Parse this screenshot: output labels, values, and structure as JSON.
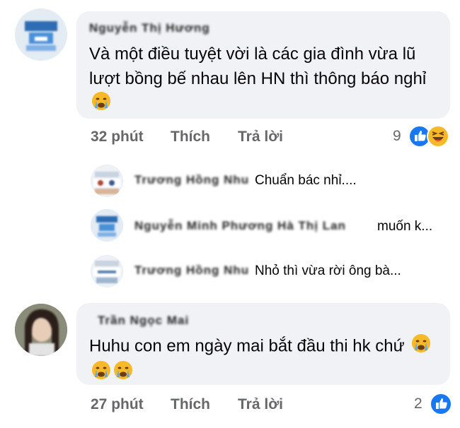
{
  "comments": [
    {
      "author": "Nguyễn Thị Hương",
      "text": "Và một điều tuyệt vời là các gia đình vừa lũ lượt bồng bế nhau lên HN thì thông báo nghỉ",
      "emoji": "crying-face",
      "time": "32 phút",
      "like_label": "Thích",
      "reply_label": "Trả lời",
      "reaction_count": "9",
      "reactions": [
        "like",
        "haha"
      ]
    },
    {
      "author": "Trần Ngọc Mai",
      "text": "Huhu con em ngày mai bắt đầu thi hk chứ",
      "emoji_count": 3,
      "time": "27 phút",
      "like_label": "Thích",
      "reply_label": "Trả lời",
      "reaction_count": "2",
      "reactions": [
        "like"
      ]
    }
  ],
  "replies": [
    {
      "author": "Trương Hồng Nhu",
      "text": "Chuẩn bác nhỉ...."
    },
    {
      "author": "Nguyễn Minh Phương Hà Thị Lan",
      "text": "muốn k..."
    },
    {
      "author": "Trương Hồng Nhu",
      "text": "Nhỏ thì vừa rời ông bà..."
    }
  ],
  "colors": {
    "bubble": "#f0f2f5",
    "meta_text": "#65676b",
    "like_blue": "#1877f2",
    "haha_yellow": "#f7b928"
  }
}
